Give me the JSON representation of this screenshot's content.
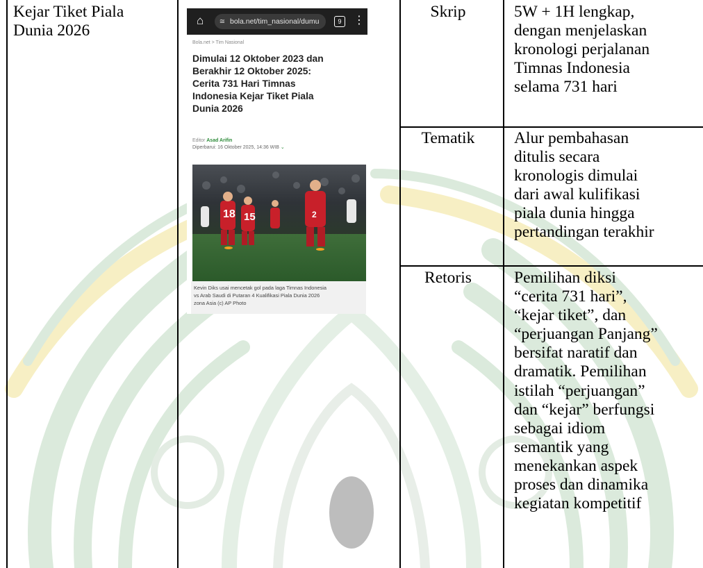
{
  "left_cell": {
    "lines": [
      "Kejar Tiket Piala",
      "Dunia 2026"
    ]
  },
  "screenshot": {
    "url": "bola.net/tim_nasional/dumu",
    "tab_count": "9",
    "breadcrumb": "Bola.net > Tim Nasional",
    "headline_lines": [
      "Dimulai 12 Oktober 2023 dan",
      "Berakhir 12 Oktober 2025:",
      "Cerita 731 Hari Timnas",
      "Indonesia Kejar Tiket Piala",
      "Dunia 2026"
    ],
    "editor_label": "Editor",
    "editor_name": "Asad Arifin",
    "updated": "Diperbarui: 16 Oktober 2025, 14:36 WIB",
    "caption_lines": [
      "Kevin Diks usai mencetak gol pada laga Timnas Indonesia",
      "vs Arab Saudi di Putaran 4 Kualifikasi Piala Dunia 2026",
      "zona Asia (c) AP Photo"
    ]
  },
  "rows": [
    {
      "aspect": "Skrip",
      "lines": [
        "5W + 1H lengkap,",
        "dengan menjelaskan",
        "kronologi perjalanan",
        "Timnas Indonesia",
        "selama 731 hari"
      ]
    },
    {
      "aspect": "Tematik",
      "lines": [
        "Alur pembahasan",
        "ditulis secara",
        "kronologis dimulai",
        "dari awal kulifikasi",
        "piala dunia hingga",
        "pertandingan terakhir"
      ]
    },
    {
      "aspect": "Retoris",
      "lines": [
        "Pemilihan diksi",
        "“cerita 731 hari”,",
        "“kejar tiket”, dan",
        "“perjuangan Panjang”",
        "bersifat naratif dan",
        "dramatik. Pemilihan",
        "istilah “perjuangan”",
        "dan “kejar” berfungsi",
        "sebagai idiom",
        "semantik yang",
        "menekankan aspek",
        "proses dan dinamika",
        "kegiatan kompetitif"
      ]
    }
  ],
  "colors": {
    "watermark_green": "#cfe3d2",
    "watermark_yellow": "#f6ecb8",
    "accent_green": "#2e8b3a"
  }
}
